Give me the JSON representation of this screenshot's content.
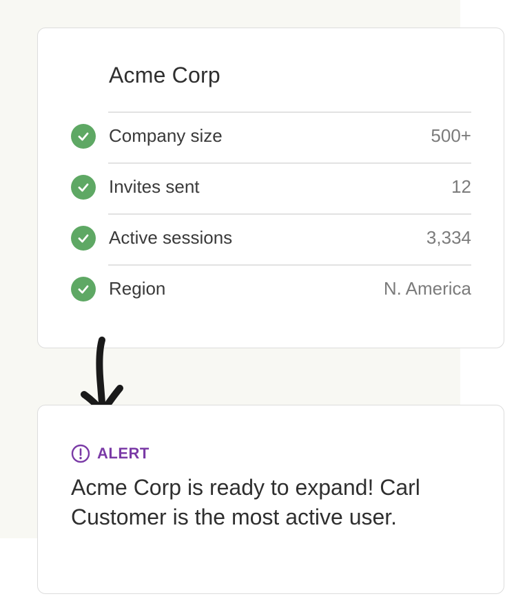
{
  "company_card": {
    "title": "Acme Corp",
    "rows": [
      {
        "label": "Company size",
        "value": "500+"
      },
      {
        "label": "Invites sent",
        "value": "12"
      },
      {
        "label": "Active sessions",
        "value": "3,334"
      },
      {
        "label": "Region",
        "value": "N. America"
      }
    ],
    "row_icon": "check-circle-icon"
  },
  "connector_icon": "hand-drawn-arrow-down-icon",
  "alert_card": {
    "icon": "exclamation-circle-icon",
    "label": "ALERT",
    "message": "Acme Corp is ready to expand! Carl Customer is the most active user."
  },
  "colors": {
    "check_green": "#5ea864",
    "alert_purple": "#7a3aa6",
    "background_panel": "#f8f8f3"
  }
}
